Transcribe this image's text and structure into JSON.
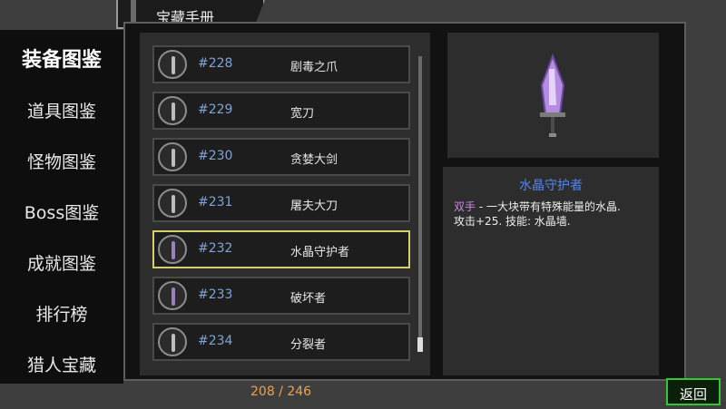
{
  "title": "宝藏手册",
  "sidebar": {
    "items": [
      {
        "label": "装备图鉴",
        "active": true
      },
      {
        "label": "道具图鉴",
        "active": false
      },
      {
        "label": "怪物图鉴",
        "active": false
      },
      {
        "label": "Boss图鉴",
        "active": false
      },
      {
        "label": "成就图鉴",
        "active": false
      },
      {
        "label": "排行榜",
        "active": false
      },
      {
        "label": "猎人宝藏",
        "active": false
      }
    ]
  },
  "list": {
    "rows": [
      {
        "num": "#228",
        "name": "剧毒之爪",
        "icon": "claw-icon"
      },
      {
        "num": "#229",
        "name": "宽刀",
        "icon": "broad-blade-icon"
      },
      {
        "num": "#230",
        "name": "贪婪大剑",
        "icon": "greatsword-icon"
      },
      {
        "num": "#231",
        "name": "屠夫大刀",
        "icon": "butcher-blade-icon"
      },
      {
        "num": "#232",
        "name": "水晶守护者",
        "icon": "crystal-sword-icon",
        "selected": true
      },
      {
        "num": "#233",
        "name": "破坏者",
        "icon": "destroyer-icon"
      },
      {
        "num": "#234",
        "name": "分裂者",
        "icon": "splitter-icon"
      }
    ]
  },
  "detail": {
    "name": "水晶守护者",
    "tag": "双手",
    "desc_line1": " - 一大块带有特殊能量的水晶.",
    "desc_line2": "攻击+25. 技能: 水晶墙."
  },
  "counter": "208 / 246",
  "back_label": "返回"
}
